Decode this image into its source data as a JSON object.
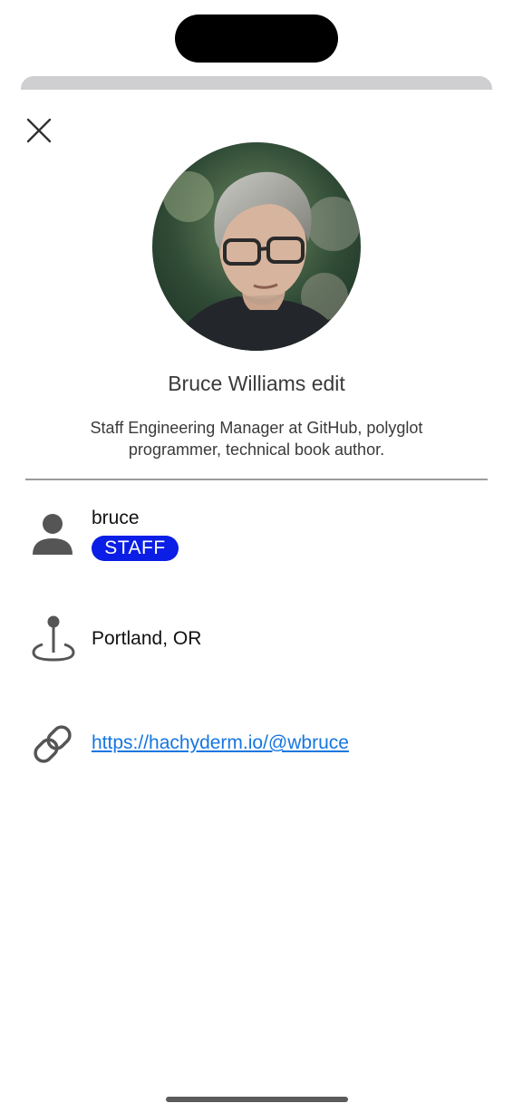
{
  "profile": {
    "display_name": "Bruce Williams",
    "edit_label": "edit",
    "bio": "Staff Engineering Manager at GitHub, polyglot programmer, technical book author.",
    "username": "bruce",
    "badge": "STAFF",
    "location": "Portland, OR",
    "website": "https://hachyderm.io/@wbruce"
  },
  "icons": {
    "close": "close-icon",
    "user": "person-icon",
    "location": "map-pin-icon",
    "link": "link-icon"
  },
  "colors": {
    "badge_background": "#0a1ee6",
    "link": "#1676e0",
    "icon": "#555555"
  }
}
